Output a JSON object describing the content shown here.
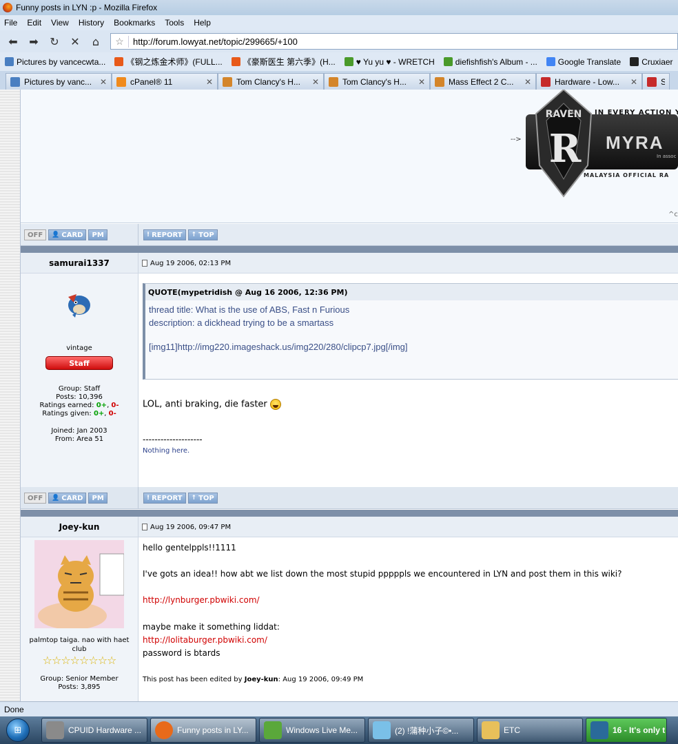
{
  "window": {
    "title": "Funny posts in LYN :p - Mozilla Firefox"
  },
  "menu": [
    "File",
    "Edit",
    "View",
    "History",
    "Bookmarks",
    "Tools",
    "Help"
  ],
  "nav": {
    "url": "http://forum.lowyat.net/topic/299665/+100"
  },
  "bookmarks": [
    {
      "label": "Pictures by vancecwta...",
      "color": "#4a7fc1"
    },
    {
      "label": "《钢之炼金术师》(FULL...",
      "color": "#e85a1a"
    },
    {
      "label": "《豪斯医生 第六季》(H...",
      "color": "#e85a1a"
    },
    {
      "label": "♥ Yu yu ♥ - WRETCH",
      "color": "#4a9a2a"
    },
    {
      "label": "diefishfish's Album - ...",
      "color": "#4a9a2a"
    },
    {
      "label": "Google Translate",
      "color": "#4285f4"
    },
    {
      "label": "Cruxiaer",
      "color": "#222"
    }
  ],
  "tabs": [
    {
      "label": "Pictures by vanc...",
      "color": "#4a7fc1"
    },
    {
      "label": "cPanel® 11",
      "color": "#f08a1c"
    },
    {
      "label": "Tom Clancy's H...",
      "color": "#d4852a"
    },
    {
      "label": "Tom Clancy's H...",
      "color": "#d4852a"
    },
    {
      "label": "Mass Effect 2 C...",
      "color": "#d4852a"
    },
    {
      "label": "Hardware - Low...",
      "color": "#c62a2a"
    },
    {
      "label": "Sea",
      "color": "#c62a2a"
    }
  ],
  "banner": {
    "arrow": "-->",
    "raven": "RAVEN",
    "tagline": "IN EVERY ACTION YOU TA",
    "brand": "MYRA",
    "assoc": "In assoc",
    "sub": "MALAYSIA OFFICIAL RA",
    "caret": "^c"
  },
  "actions": {
    "off": "OFF",
    "card": "CARD",
    "pm": "PM",
    "report": "REPORT",
    "top": "TOP"
  },
  "posts": [
    {
      "user": "samurai1337",
      "date": "Aug 19 2006, 02:13 PM",
      "title": "vintage",
      "rank": "Staff",
      "group": "Group: Staff",
      "posts": "Posts: 10,396",
      "earned_label": "Ratings earned:",
      "earned_pos": "0+",
      "earned_neg": "0-",
      "given_label": "Ratings given:",
      "given_pos": "0+",
      "given_neg": "0-",
      "joined": "Joined: Jan 2003",
      "from": "From: Area 51",
      "quote_head": "QUOTE(mypetridish @ Aug 16 2006, 12:36 PM)",
      "quote_lines": [
        "thread title: What is the use of ABS, Fast n Furious",
        "description: a dickhead trying to be a smartass",
        "[img11]http://img220.imageshack.us/img220/280/clipcp7.jpg[/img]"
      ],
      "body": "LOL, anti braking, die faster",
      "sig_sep": "--------------------",
      "sig": "Nothing here."
    },
    {
      "user": "Joey-kun",
      "date": "Aug 19 2006, 09:47 PM",
      "title": "palmtop taiga. nao with haet club",
      "stars": "☆☆☆☆☆☆☆☆",
      "group": "Group: Senior Member",
      "posts": "Posts: 3,895",
      "l1": "hello gentelppls!!1111",
      "l2": "I've gots an idea!! how abt we list down the most stupid pppppls we encountered in LYN and post them in this wiki?",
      "link1": "http://lynburger.pbwiki.com/",
      "l3": "maybe make it something liddat:",
      "link2": "http://lolitaburger.pbwiki.com/",
      "l4": "password is btards",
      "edited_pre": "This post has been edited by ",
      "edited_user": "Joey-kun",
      "edited_post": ": Aug 19 2006, 09:49 PM"
    }
  ],
  "status": "Done",
  "taskbar": [
    {
      "label": "CPUID Hardware ...",
      "color": "#8a8a8a"
    },
    {
      "label": "Funny posts in LY...",
      "color": "#e86a1a"
    },
    {
      "label": "Windows Live Me...",
      "color": "#5aa83a"
    },
    {
      "label": "(2) !蒲种小子©•...",
      "color": "#7ac0e8"
    },
    {
      "label": "ETC",
      "color": "#e8c05a"
    },
    {
      "label": "16 - It's only t",
      "color": "#2a6a9a"
    }
  ]
}
